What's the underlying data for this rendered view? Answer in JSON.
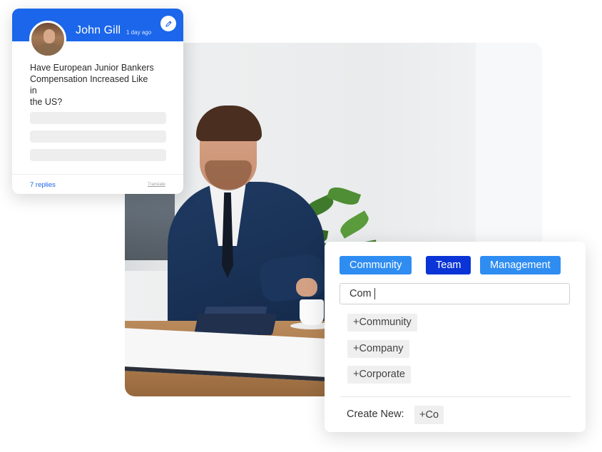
{
  "post": {
    "author": "John Gill",
    "time": "1 day ago",
    "question": "Have European Junior Bankers\nCompensation Increased Like\nin\nthe US?",
    "replies": "7 replies",
    "translate": "Translate",
    "edit_icon": "pencil-icon"
  },
  "tags": {
    "chips": [
      {
        "label": "Community",
        "style": "light"
      },
      {
        "label": "Team",
        "style": "dark"
      },
      {
        "label": "Management",
        "style": "light"
      }
    ],
    "input_value": "Com",
    "suggestions": [
      "+Community",
      "+Company",
      "+Corporate"
    ],
    "create_label": "Create New:",
    "create_value": "+Co"
  },
  "colors": {
    "brand_blue": "#1b66ea",
    "chip_light": "#2f8df2",
    "chip_dark": "#0a34d6"
  }
}
